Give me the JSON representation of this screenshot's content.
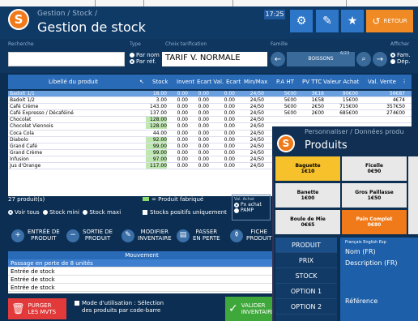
{
  "header": {
    "breadcrumb": "Gestion / Stock /",
    "title": "Gestion de stock",
    "clock": "17:25",
    "retour": "RETOUR",
    "logo": "S"
  },
  "filters": {
    "recherche": "Recherche",
    "type": "Type",
    "par_nom": "Par nom",
    "par_ref": "Par réf.",
    "choix_tarif": "Choix tarification",
    "tarif": "TARIF V.  NORMALE",
    "famille": "Famille",
    "famille_val": "BOISSONS",
    "famille_count": "6/23",
    "afficher": "Afficher",
    "fam": "Fam.",
    "dep": "Dép."
  },
  "table": {
    "columns": [
      "Libellé du produit",
      "Stock",
      "Invent",
      "Ecart Val.",
      "Ecart",
      "Min/Max",
      "P.A HT",
      "PV TTC",
      "Valeur Achat",
      "Val. Vente"
    ],
    "rows": [
      [
        "Badoit 1/1",
        "18.00",
        "0.00",
        "0.00",
        "0.00",
        "24/50",
        "5€00",
        "3€16",
        "90€00",
        "56€87"
      ],
      [
        "Badoit 1/2",
        "3.00",
        "0.00",
        "0.00",
        "0.00",
        "24/50",
        "5€00",
        "1€58",
        "15€00",
        "4€74"
      ],
      [
        "Café Crème",
        "143.00",
        "0.00",
        "0.00",
        "0.00",
        "24/50",
        "5€00",
        "2€50",
        "715€00",
        "357€50"
      ],
      [
        "Café Expresso / Décaféiné",
        "137.00",
        "0.00",
        "0.00",
        "0.00",
        "24/50",
        "5€00",
        "2€00",
        "685€00",
        "274€00"
      ],
      [
        "Chocolat",
        "128.00",
        "0.00",
        "0.00",
        "0.00",
        "24/50",
        "",
        "",
        "",
        ""
      ],
      [
        "Chocolat Viennois",
        "128.00",
        "0.00",
        "0.00",
        "0.00",
        "24/50",
        "",
        "",
        "",
        ""
      ],
      [
        "Coca Cola",
        "44.00",
        "0.00",
        "0.00",
        "0.00",
        "24/50",
        "",
        "",
        "",
        ""
      ],
      [
        "Diabolo",
        "92.00",
        "0.00",
        "0.00",
        "0.00",
        "24/50",
        "",
        "",
        "",
        ""
      ],
      [
        "Grand Café",
        "99.00",
        "0.00",
        "0.00",
        "0.00",
        "24/50",
        "",
        "",
        "",
        ""
      ],
      [
        "Grand Crème",
        "99.00",
        "0.00",
        "0.00",
        "0.00",
        "24/50",
        "",
        "",
        "",
        ""
      ],
      [
        "Infusion",
        "97.00",
        "0.00",
        "0.00",
        "0.00",
        "24/50",
        "",
        "",
        "",
        ""
      ],
      [
        "Jus d'Orange",
        "117.00",
        "0.00",
        "0.00",
        "0.00",
        "24/50",
        "",
        "",
        "",
        ""
      ]
    ]
  },
  "status": {
    "count": "27 produit(s)",
    "fabrique": "= Produit fabriqué",
    "voir_tous": "Voir tous",
    "stock_mini": "Stock mini",
    "stock_maxi": "Stock maxi",
    "stocks_positifs": "Stocks positifs uniquement",
    "val_achat": "Val. Achat",
    "px_achat": "Px achat",
    "pamp": "PAMP"
  },
  "actions": {
    "entree": "ENTRÉE DE\nPRODUIT",
    "sortie": "SORTIE DE\nPRODUIT",
    "modifier": "MODIFIER\nINVENTAIRE",
    "passer": "PASSER\nEN PERTE",
    "fiche": "FICHE\nPRODUIT"
  },
  "movement": {
    "title": "Mouvement",
    "rows": [
      "Passage en perte de 8 unités",
      "Entrée de stock",
      "Entrée de stock",
      "Entrée de stock"
    ]
  },
  "footer": {
    "purger": "PURGER\nLES MVTS",
    "mode_line1": "Mode d'utilisation : Sélection",
    "mode_line2": "des produits par code-barre",
    "valider": "VALIDER\nINVENTAIRE"
  },
  "panel": {
    "breadcrumb": "Personnaliser / Données produ",
    "title": "Produits",
    "logo": "S",
    "tiles": [
      {
        "name": "Baguette",
        "price": "1€10"
      },
      {
        "name": "Ficelle",
        "price": "0€90"
      },
      {
        "name": "Banette",
        "price": "1€00"
      },
      {
        "name": "Gros Paillasse",
        "price": "1€50"
      },
      {
        "name": "Boule de Mie",
        "price": "0€65"
      },
      {
        "name": "Pain Complet",
        "price": "0€80"
      }
    ],
    "tabs": [
      "PRODUIT",
      "PRIX",
      "STOCK",
      "OPTION 1",
      "OPTION 2"
    ],
    "langs": "Français  English  Esp",
    "nom": "Nom (FR)",
    "description": "Description (FR)",
    "reference": "Référence"
  }
}
